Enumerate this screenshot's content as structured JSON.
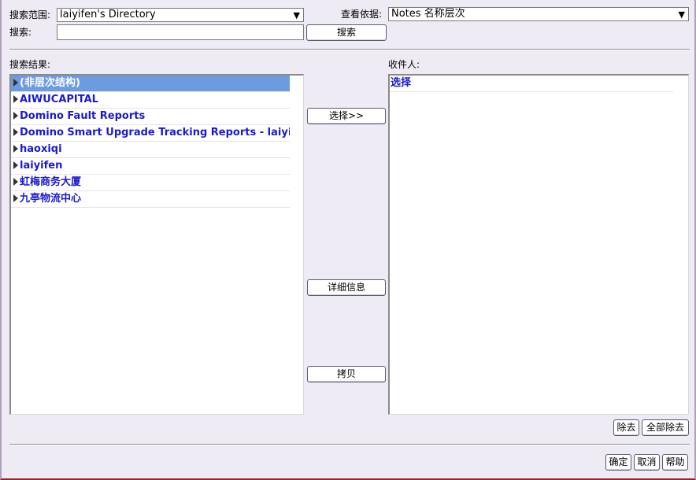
{
  "search_scope": {
    "label": "搜索范围:",
    "value": "laiyifen's Directory"
  },
  "view_by": {
    "label": "查看依据:",
    "value": "Notes 名称层次"
  },
  "search": {
    "label": "搜索:",
    "value": "",
    "button": "搜索"
  },
  "results": {
    "label": "搜索结果:",
    "items": [
      "(非层次结构)",
      "AIWUCAPITAL",
      "Domino Fault Reports",
      "Domino Smart Upgrade Tracking Reports - laiyifen",
      "haoxiqi",
      "laiyifen",
      "虹梅商务大厦",
      "九亭物流中心"
    ],
    "selected_index": 0
  },
  "recipients": {
    "label": "收件人:",
    "items": [
      "选择"
    ]
  },
  "actions": {
    "select": "选择>>",
    "details": "详细信息",
    "copy": "拷贝"
  },
  "recipient_actions": {
    "remove": "除去",
    "remove_all": "全部除去"
  },
  "dialog_buttons": {
    "ok": "确定",
    "cancel": "取消",
    "help": "帮助"
  },
  "icons": {
    "dropdown": "chevron-down-icon",
    "expand": "expand-triangle-icon"
  },
  "colors": {
    "link_blue": "#1A1ACD",
    "selection": "#6C9BE0",
    "background": "#EFEBF5"
  }
}
